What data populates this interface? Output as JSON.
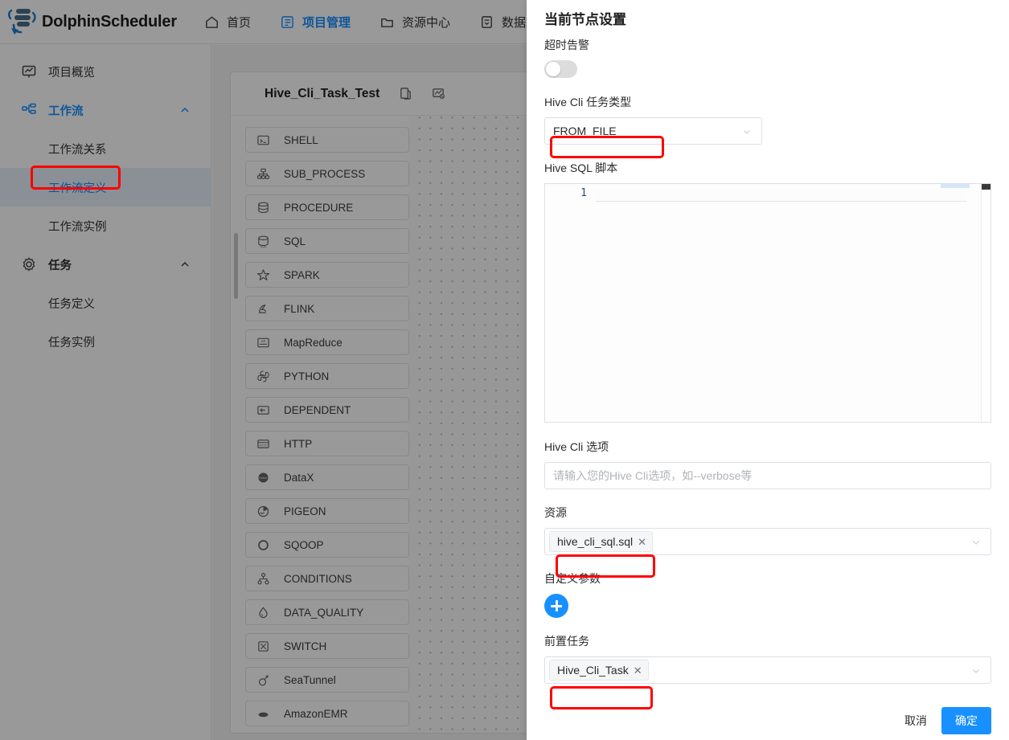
{
  "app": {
    "brand": "DolphinScheduler",
    "accent": "#1890ff",
    "annotation_color": "#ff0000"
  },
  "topnav": {
    "items": [
      {
        "label": "首页",
        "icon": "home-icon",
        "active": false
      },
      {
        "label": "项目管理",
        "icon": "project-icon",
        "active": true
      },
      {
        "label": "资源中心",
        "icon": "folder-icon",
        "active": false
      },
      {
        "label": "数据质量",
        "icon": "data-quality-icon",
        "active": false
      }
    ]
  },
  "sidebar": {
    "items": [
      {
        "label": "项目概览",
        "icon": "overview-icon",
        "level": "top",
        "selected": false,
        "collapsible": false
      },
      {
        "label": "工作流",
        "icon": "workflow-icon",
        "level": "group",
        "selected": false,
        "collapsible": true
      },
      {
        "label": "工作流关系",
        "icon": "",
        "level": "sub",
        "selected": false,
        "collapsible": false
      },
      {
        "label": "工作流定义",
        "icon": "",
        "level": "sub",
        "selected": true,
        "collapsible": false
      },
      {
        "label": "工作流实例",
        "icon": "",
        "level": "sub",
        "selected": false,
        "collapsible": false
      },
      {
        "label": "任务",
        "icon": "gear-icon",
        "level": "group",
        "selected": false,
        "collapsible": true
      },
      {
        "label": "任务定义",
        "icon": "",
        "level": "sub",
        "selected": false,
        "collapsible": false
      },
      {
        "label": "任务实例",
        "icon": "",
        "level": "sub",
        "selected": false,
        "collapsible": false
      }
    ]
  },
  "workflow": {
    "title": "Hive_Cli_Task_Test",
    "task_types": [
      {
        "label": "SHELL",
        "icon": "shell-icon"
      },
      {
        "label": "SUB_PROCESS",
        "icon": "sub-process-icon"
      },
      {
        "label": "PROCEDURE",
        "icon": "procedure-icon"
      },
      {
        "label": "SQL",
        "icon": "sql-icon"
      },
      {
        "label": "SPARK",
        "icon": "spark-icon"
      },
      {
        "label": "FLINK",
        "icon": "flink-icon"
      },
      {
        "label": "MapReduce",
        "icon": "mapreduce-icon"
      },
      {
        "label": "PYTHON",
        "icon": "python-icon"
      },
      {
        "label": "DEPENDENT",
        "icon": "dependent-icon"
      },
      {
        "label": "HTTP",
        "icon": "http-icon"
      },
      {
        "label": "DataX",
        "icon": "datax-icon"
      },
      {
        "label": "PIGEON",
        "icon": "pigeon-icon"
      },
      {
        "label": "SQOOP",
        "icon": "sqoop-icon"
      },
      {
        "label": "CONDITIONS",
        "icon": "conditions-icon"
      },
      {
        "label": "DATA_QUALITY",
        "icon": "data-quality-icon"
      },
      {
        "label": "SWITCH",
        "icon": "switch-icon"
      },
      {
        "label": "SeaTunnel",
        "icon": "seatunnel-icon"
      },
      {
        "label": "AmazonEMR",
        "icon": "amazon-emr-icon"
      }
    ]
  },
  "drawer": {
    "title": "当前节点设置",
    "timeout_alarm": {
      "label": "超时告警",
      "enabled": false
    },
    "task_type": {
      "label": "Hive Cli 任务类型",
      "value": "FROM_FILE",
      "highlighted": true
    },
    "sql_script": {
      "label": "Hive SQL 脚本",
      "line_number": "1",
      "content": ""
    },
    "cli_options": {
      "label": "Hive Cli 选项",
      "value": "",
      "placeholder": "请输入您的Hive Cli选项，如--verbose等"
    },
    "resource": {
      "label": "资源",
      "tags": [
        "hive_cli_sql.sql"
      ],
      "highlighted": true
    },
    "custom_params": {
      "label": "自定义参数",
      "add_icon": "plus-icon"
    },
    "pre_tasks": {
      "label": "前置任务",
      "tags": [
        "Hive_Cli_Task"
      ],
      "highlighted": true
    },
    "footer": {
      "cancel": "取消",
      "confirm": "确定"
    }
  }
}
